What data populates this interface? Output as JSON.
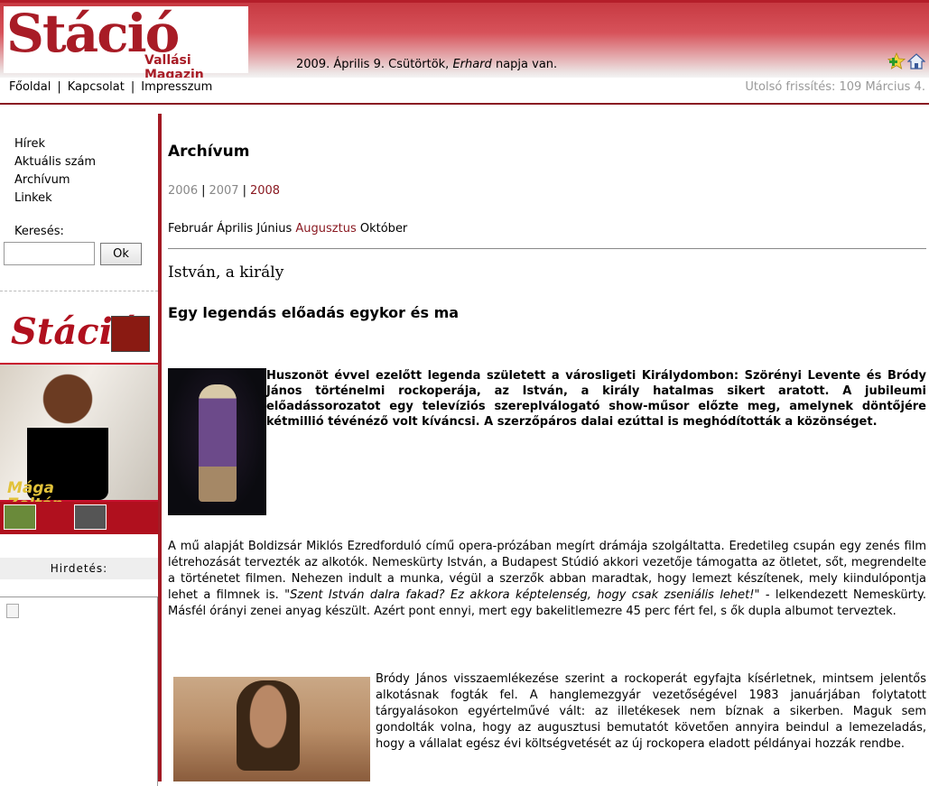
{
  "header": {
    "logo_main": "Stáció",
    "logo_sub": "Vallási Magazin",
    "date_prefix": "2009. Április 9. Csütörtök, ",
    "name_of_day": "Erhard",
    "date_suffix": " napja van.",
    "icons": [
      "add-favorite-icon",
      "home-icon"
    ]
  },
  "topnav": {
    "items": [
      "Főoldal",
      "Kapcsolat",
      "Impresszum"
    ],
    "last_update": "Utolsó frissítés: 109 Március 4."
  },
  "sidebar": {
    "nav": [
      "Hírek",
      "Aktuális szám",
      "Archívum",
      "Linkek"
    ],
    "search_label": "Keresés:",
    "search_value": "",
    "search_button": "Ok",
    "cover": {
      "masthead": "Stáció",
      "headline_line1": "Mága",
      "headline_line2": "Zoltán"
    },
    "ad_label": "Hirdetés:"
  },
  "main": {
    "title": "Archívum",
    "years": [
      "2006",
      "2007",
      "2008"
    ],
    "months": [
      "Február",
      "Április",
      "Június",
      "Augusztus",
      "Október"
    ],
    "article_title": "István, a király",
    "subtitle": "Egy legendás előadás egykor és ma",
    "lead": "Huszonöt évvel ezelőtt legenda született a városligeti Királydombon: Szörényi Levente és Bródy János történelmi rockoperája, az István, a király hatalmas sikert aratott. A jubileumi előadássorozatot egy televíziós szereplválogató show-műsor előzte meg, amelynek döntőjére kétmillió tévénéző volt kíváncsi. A szerzőpáros dalai ezúttal is meghódították a közönséget.",
    "paragraph1_a": "A mű alapját Boldizsár Miklós Ezredforduló című opera-prózában megírt drámája szolgáltatta. Eredetileg csupán egy zenés film létrehozását tervezték az alkotók. Nemeskürty István, a Budapest Stúdió akkori vezetője támogatta az ötletet, sőt, megrendelte a történetet filmen. Nehezen indult a munka, végül a szerzők abban maradtak, hogy lemezt készítenek, mely kiindulópontja lehet a filmnek is. ",
    "paragraph1_quote": "\"Szent István dalra fakad? Ez akkora képtelenség, hogy csak zseniális lehet!\"",
    "paragraph1_b": " - lelkendezett Nemeskürty. Másfél órányi zenei anyag készült. Azért pont ennyi, mert egy bakelitlemezre 45 perc fért fel, s ők dupla albumot terveztek.",
    "paragraph2": "Bródy János visszaemlékezése szerint a rockoperát egyfajta kísérletnek, mintsem jelentős alkotásnak fogták fel. A hanglemezgyár vezetőségével 1983 januárjában folytatott tárgyalásokon egyértelművé vált: az illetékesek nem bíznak a sikerben. Maguk sem gondolták volna, hogy az augusztusi bemutatót követően annyira beindul a lemezeladás, hogy a vállalat egész évi költségvetését az új rockopera eladott példányai hozzák rendbe."
  }
}
